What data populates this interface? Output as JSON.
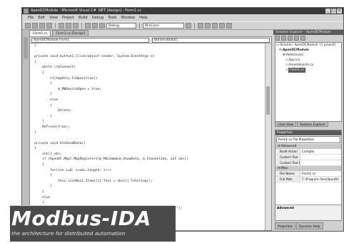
{
  "window": {
    "title": "ApenDCModule - Microsoft Visual C# .NET [design] - Form1.cs"
  },
  "menu": {
    "items": [
      "File",
      "Edit",
      "View",
      "Project",
      "Build",
      "Debug",
      "Tools",
      "Window",
      "Help"
    ]
  },
  "toolbar": {
    "config_select": "Debug",
    "search_select": "WinConn"
  },
  "editor": {
    "tabs": [
      "Form1.cs",
      "Form1.cs [Design]"
    ],
    "class_select": "ApenDCModule.Form1",
    "member_select": "btnSendData()"
  },
  "code_lines": [
    "}",
    "",
    "private void button1_Click(object sender, System.EventArgs e)",
    "{",
    "    while (rbConnect)",
    "    {",
    "        if(tmpOnly.IsOpen(true))",
    "        {",
    "            m_MbDeviceOpen = true;",
    "        }",
    "        else",
    "        {",
    "            Delete;",
    "        }",
    "    }",
    "    Refresh(true);",
    "}",
    "",
    "private void btnSendData()",
    "{",
    "    int[] vbs;",
    "    if (ApenDC.Mbpl.MbpRegisters(m_MbCommand,ShowData, m_ChannelIdx, out vbs))",
    "    {",
    "        for(int i=0; i<vbs.Length; i++)",
    "        {",
    "            this.listBox1.Items[i].Text = vbs[i].ToString();",
    "        }",
    "    }",
    "    else",
    "    {",
    "        MessageBox.Show(\"Apdu\",\"ApenDC.ErrorCode\"+ApiError.ToString()+\"*\");",
    "    }",
    "}",
    "",
    "private void listView1_Click(object sender, System.EventArgs e)",
    "{",
    "    if(p_Code)",
    "    {"
  ],
  "solution_explorer": {
    "title": "Solution Explorer - ApenDCModule",
    "items": [
      "Solution 'ApenDCModule' (1 project)",
      "ApenDCModule",
      "References",
      "App.ico",
      "AssemblyInfo.cs",
      "Form1.cs"
    ],
    "tabs": [
      "Class View",
      "Solution Explorer"
    ]
  },
  "properties": {
    "title": "Properties",
    "object_select": "Form1.cs File Properties",
    "category_advanced": "Advanced",
    "rows": [
      {
        "name": "Build Action",
        "value": "Compile"
      },
      {
        "name": "Custom Tool",
        "value": ""
      },
      {
        "name": "Custom Tool N",
        "value": ""
      }
    ],
    "category_misc": "Misc",
    "misc_rows": [
      {
        "name": "File Name",
        "value": "Form1.cs"
      },
      {
        "name": "Full Path",
        "value": "C:\\Program Files\\ApenDC"
      }
    ],
    "desc_title": "Advanced"
  },
  "bottom_tabs": [
    "Properties",
    "Dynamic Help"
  ],
  "logo": {
    "title": "Modbus-IDA",
    "subtitle": "the architecture for distributed automation"
  }
}
